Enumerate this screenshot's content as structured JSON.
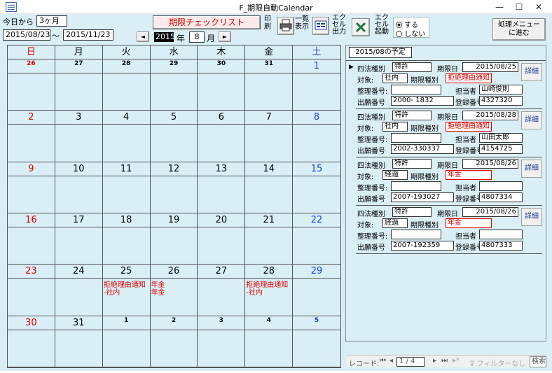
{
  "window": {
    "title": "F_期限自動Calendar",
    "minimize": "—",
    "maximize": "☐",
    "close": "✕"
  },
  "toolbar": {
    "period_label": "今日から",
    "period_value": "3ヶ月",
    "date_from": "2015/08/23",
    "date_sep": "〜",
    "date_to": "2015/11/23",
    "checklist_button": "期限チェックリスト",
    "print_label": "印刷",
    "list_label": "一覧表示",
    "excel_out_label": "エクセル出力",
    "excel_launch_label": "エクセル起動",
    "radio_yes": "する",
    "radio_no": "しない",
    "menu_button": "処理メニュー\nに進む",
    "year_value": "2015",
    "year_label": "年",
    "month_value": "8",
    "month_label": "月",
    "prev": "◄",
    "next": "►"
  },
  "calendar": {
    "weekdays": [
      "日",
      "月",
      "火",
      "水",
      "木",
      "金",
      "土"
    ],
    "weeks": [
      [
        {
          "day": "26",
          "small": true,
          "color": "red",
          "event": ""
        },
        {
          "day": "27",
          "small": true,
          "color": "black",
          "event": ""
        },
        {
          "day": "28",
          "small": true,
          "color": "black",
          "event": ""
        },
        {
          "day": "29",
          "small": true,
          "color": "black",
          "event": ""
        },
        {
          "day": "30",
          "small": true,
          "color": "black",
          "event": ""
        },
        {
          "day": "31",
          "small": true,
          "color": "black",
          "event": ""
        },
        {
          "day": "1",
          "small": false,
          "color": "blue",
          "event": ""
        }
      ],
      [
        {
          "day": "2",
          "small": false,
          "color": "red",
          "event": ""
        },
        {
          "day": "3",
          "small": false,
          "color": "black",
          "event": ""
        },
        {
          "day": "4",
          "small": false,
          "color": "black",
          "event": ""
        },
        {
          "day": "5",
          "small": false,
          "color": "black",
          "event": ""
        },
        {
          "day": "6",
          "small": false,
          "color": "black",
          "event": ""
        },
        {
          "day": "7",
          "small": false,
          "color": "black",
          "event": ""
        },
        {
          "day": "8",
          "small": false,
          "color": "blue",
          "event": ""
        }
      ],
      [
        {
          "day": "9",
          "small": false,
          "color": "red",
          "event": ""
        },
        {
          "day": "10",
          "small": false,
          "color": "black",
          "event": ""
        },
        {
          "day": "11",
          "small": false,
          "color": "black",
          "event": ""
        },
        {
          "day": "12",
          "small": false,
          "color": "black",
          "event": ""
        },
        {
          "day": "13",
          "small": false,
          "color": "black",
          "event": ""
        },
        {
          "day": "14",
          "small": false,
          "color": "black",
          "event": ""
        },
        {
          "day": "15",
          "small": false,
          "color": "blue",
          "event": ""
        }
      ],
      [
        {
          "day": "16",
          "small": false,
          "color": "red",
          "event": ""
        },
        {
          "day": "17",
          "small": false,
          "color": "black",
          "event": ""
        },
        {
          "day": "18",
          "small": false,
          "color": "black",
          "event": ""
        },
        {
          "day": "19",
          "small": false,
          "color": "black",
          "event": ""
        },
        {
          "day": "20",
          "small": false,
          "color": "black",
          "event": ""
        },
        {
          "day": "21",
          "small": false,
          "color": "black",
          "event": ""
        },
        {
          "day": "22",
          "small": false,
          "color": "blue",
          "event": ""
        }
      ],
      [
        {
          "day": "23",
          "small": false,
          "color": "red",
          "event": ""
        },
        {
          "day": "24",
          "small": false,
          "color": "black",
          "event": ""
        },
        {
          "day": "25",
          "small": false,
          "color": "black",
          "event": "拒絶理由通知\n-社内"
        },
        {
          "day": "26",
          "small": false,
          "color": "black",
          "event": "年金\n年金"
        },
        {
          "day": "27",
          "small": false,
          "color": "black",
          "event": ""
        },
        {
          "day": "28",
          "small": false,
          "color": "black",
          "event": "拒絶理由通知\n-社内"
        },
        {
          "day": "29",
          "small": false,
          "color": "blue",
          "event": ""
        }
      ],
      [
        {
          "day": "30",
          "small": false,
          "color": "red",
          "event": ""
        },
        {
          "day": "31",
          "small": false,
          "color": "black",
          "event": ""
        },
        {
          "day": "1",
          "small": true,
          "color": "black",
          "event": ""
        },
        {
          "day": "2",
          "small": true,
          "color": "black",
          "event": ""
        },
        {
          "day": "3",
          "small": true,
          "color": "black",
          "event": ""
        },
        {
          "day": "4",
          "small": true,
          "color": "black",
          "event": ""
        },
        {
          "day": "5",
          "small": true,
          "color": "blue",
          "event": ""
        }
      ]
    ]
  },
  "schedule": {
    "header": "2015/08の予定",
    "labels": {
      "law_type": "四法種別",
      "deadline": "期限日",
      "target": "対象:",
      "deadline_type": "期限種別",
      "ref_no": "整理番号:",
      "person": "担当者",
      "app_no": "出願番号",
      "reg_no": "登録番号",
      "detail": "詳細"
    },
    "records": [
      {
        "law_type": "特許",
        "deadline": "2015/08/25",
        "target": "社内",
        "deadline_type": "拒絶理由通知",
        "ref_no": "",
        "person": "山崎俊則",
        "app_no": "2000- 1832",
        "reg_no": "4327320"
      },
      {
        "law_type": "特許",
        "deadline": "2015/08/28",
        "target": "社内",
        "deadline_type": "拒絶理由通知",
        "ref_no": "",
        "person": "山田太郎",
        "app_no": "2002-330337",
        "reg_no": "4154725"
      },
      {
        "law_type": "特許",
        "deadline": "2015/08/26",
        "target": "経過",
        "deadline_type": "年金",
        "ref_no": "",
        "person": "",
        "app_no": "2007-193027",
        "reg_no": "4807334"
      },
      {
        "law_type": "特許",
        "deadline": "2015/08/26",
        "target": "経過",
        "deadline_type": "年金",
        "ref_no": "",
        "person": "",
        "app_no": "2007-192359",
        "reg_no": "4807333"
      }
    ]
  },
  "nav": {
    "record_label": "レコード:",
    "position": "1 / 4",
    "filter": "フィルターなし",
    "search": "検索",
    "first": "⏮",
    "prev": "◂",
    "next": "▸",
    "last": "⏭",
    "new": "▸*"
  }
}
